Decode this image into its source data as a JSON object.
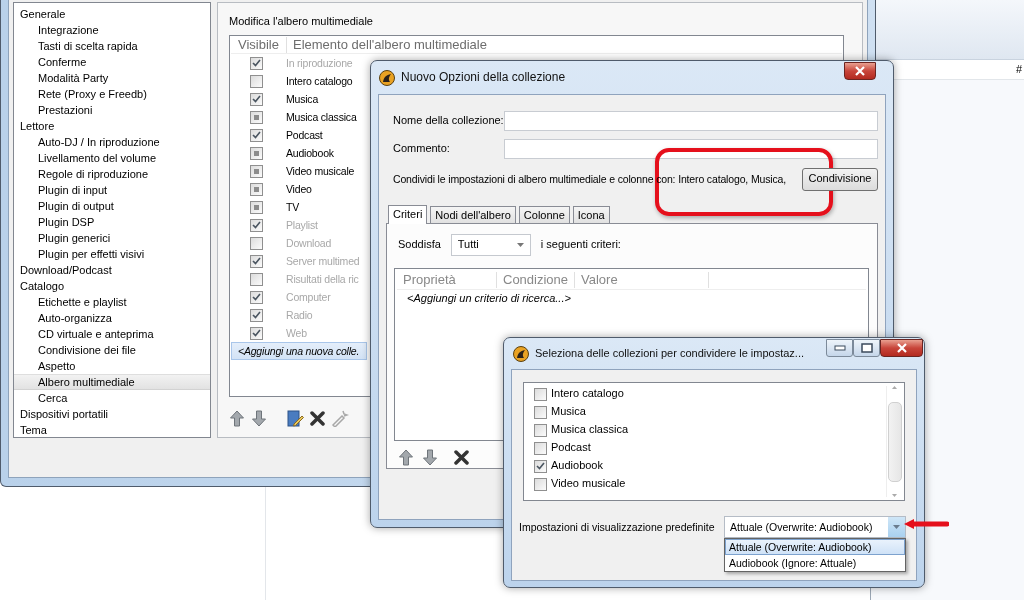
{
  "background_window": {
    "column_heading": "#"
  },
  "preferences_window": {
    "tree": [
      {
        "label": "Generale",
        "selected": false,
        "children": [
          {
            "label": "Integrazione",
            "selected": false
          },
          {
            "label": "Tasti di scelta rapida",
            "selected": false
          },
          {
            "label": "Conferme",
            "selected": false
          },
          {
            "label": "Modalità Party",
            "selected": false
          },
          {
            "label": "Rete (Proxy e Freedb)",
            "selected": false
          },
          {
            "label": "Prestazioni",
            "selected": false
          }
        ]
      },
      {
        "label": "Lettore",
        "selected": false,
        "children": [
          {
            "label": "Auto-DJ / In riproduzione",
            "selected": false
          },
          {
            "label": "Livellamento del volume",
            "selected": false
          },
          {
            "label": "Regole di riproduzione",
            "selected": false
          },
          {
            "label": "Plugin di input",
            "selected": false
          },
          {
            "label": "Plugin di output",
            "selected": false
          },
          {
            "label": "Plugin DSP",
            "selected": false
          },
          {
            "label": "Plugin generici",
            "selected": false
          },
          {
            "label": "Plugin per effetti visivi",
            "selected": false
          }
        ]
      },
      {
        "label": "Download/Podcast",
        "selected": false
      },
      {
        "label": "Catalogo",
        "selected": false,
        "children": [
          {
            "label": "Etichette e playlist",
            "selected": false
          },
          {
            "label": "Auto-organizza",
            "selected": false
          },
          {
            "label": "CD virtuale e anteprima",
            "selected": false
          },
          {
            "label": "Condivisione dei file",
            "selected": false
          },
          {
            "label": "Aspetto",
            "selected": false
          },
          {
            "label": "Albero multimediale",
            "selected": true
          },
          {
            "label": "Cerca",
            "selected": false
          }
        ]
      },
      {
        "label": "Dispositivi portatili",
        "selected": false
      },
      {
        "label": "Tema",
        "selected": false
      }
    ],
    "panel_title": "Modifica l'albero multimediale",
    "collections_table": {
      "columns": [
        "Visibile",
        "Elemento dell'albero multimediale"
      ],
      "rows": [
        {
          "label": "In riproduzione",
          "checked": true,
          "indeterminate": false,
          "disabled": true
        },
        {
          "label": "Intero catalogo",
          "checked": false,
          "indeterminate": false,
          "disabled": false
        },
        {
          "label": "Musica",
          "checked": true,
          "indeterminate": false,
          "disabled": false
        },
        {
          "label": "Musica classica",
          "checked": false,
          "indeterminate": true,
          "disabled": false
        },
        {
          "label": "Podcast",
          "checked": true,
          "indeterminate": false,
          "disabled": false
        },
        {
          "label": "Audiobook",
          "checked": false,
          "indeterminate": true,
          "disabled": false
        },
        {
          "label": "Video musicale",
          "checked": false,
          "indeterminate": true,
          "disabled": false
        },
        {
          "label": "Video",
          "checked": false,
          "indeterminate": true,
          "disabled": false
        },
        {
          "label": "TV",
          "checked": false,
          "indeterminate": true,
          "disabled": false
        },
        {
          "label": "Playlist",
          "checked": true,
          "indeterminate": false,
          "disabled": true
        },
        {
          "label": "Download",
          "checked": false,
          "indeterminate": false,
          "disabled": true
        },
        {
          "label": "Server multimed",
          "checked": true,
          "indeterminate": false,
          "disabled": true
        },
        {
          "label": "Risultati della ric",
          "checked": false,
          "indeterminate": false,
          "disabled": true
        },
        {
          "label": "Computer",
          "checked": true,
          "indeterminate": false,
          "disabled": true
        },
        {
          "label": "Radio",
          "checked": true,
          "indeterminate": false,
          "disabled": true
        },
        {
          "label": "Web",
          "checked": true,
          "indeterminate": false,
          "disabled": true
        }
      ],
      "add_row": {
        "label": "<Aggiungi una nuova colle.",
        "selected": true
      }
    }
  },
  "collection_dialog": {
    "title": "Nuovo Opzioni della collezione",
    "fields": [
      {
        "label": "Nome della collezione:"
      },
      {
        "label": "Commento:"
      }
    ],
    "share": {
      "text": "Condividi le impostazioni di albero multimediale e colonne con: Intero catalogo, Musica,",
      "button": "Condivisione"
    },
    "tabs": [
      {
        "label": "Criteri",
        "selected": true
      },
      {
        "label": "Nodi dell'albero",
        "selected": false
      },
      {
        "label": "Colonne",
        "selected": false
      },
      {
        "label": "Icona",
        "selected": false
      }
    ],
    "match": {
      "label": "Soddisfa",
      "value": "Tutti",
      "suffix": "i seguenti criteri:"
    },
    "criteria_table": {
      "columns": [
        "Proprietà",
        "Condizione",
        "Valore"
      ],
      "add_row": "<Aggiungi un criterio di ricerca...>"
    }
  },
  "share_dialog": {
    "title": "Seleziona delle collezioni per condividere le impostaz...",
    "items": [
      {
        "label": "Intero catalogo",
        "checked": false
      },
      {
        "label": "Musica",
        "checked": false
      },
      {
        "label": "Musica classica",
        "checked": false
      },
      {
        "label": "Podcast",
        "checked": false
      },
      {
        "label": "Audiobook",
        "checked": true
      },
      {
        "label": "Video musicale",
        "checked": false
      }
    ],
    "default_view": {
      "label": "Impostazioni di visualizzazione predefinite",
      "value": "Attuale (Overwrite: Audiobook)",
      "options": [
        {
          "label": "Attuale (Overwrite: Audiobook)",
          "selected": true
        },
        {
          "label": "Audiobook (Ignore: Attuale)",
          "selected": false
        }
      ]
    }
  }
}
